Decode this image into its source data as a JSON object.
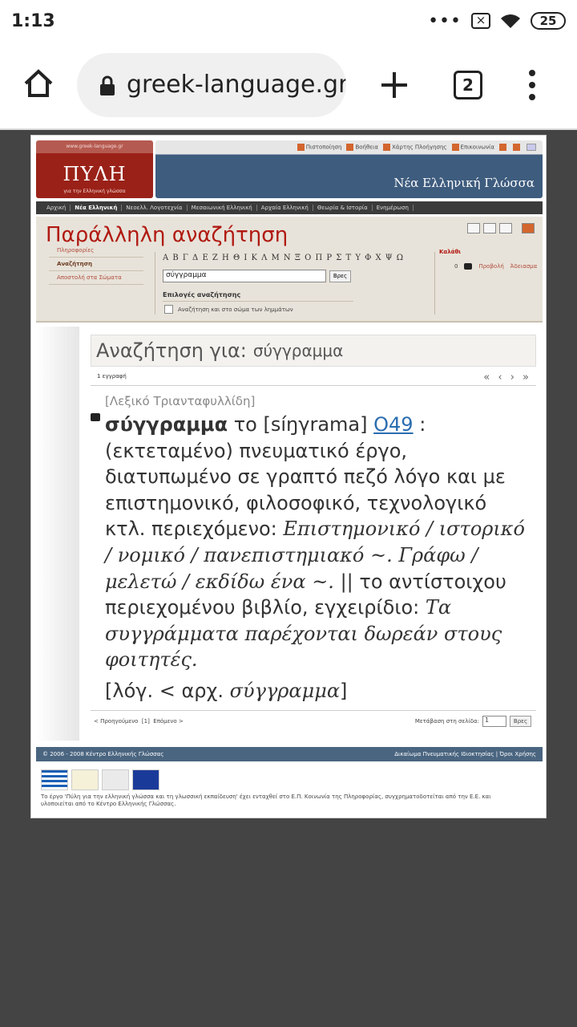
{
  "status": {
    "time": "1:13",
    "battery": "25"
  },
  "browser": {
    "url": "greek-language.gr",
    "tab_count": "2"
  },
  "site": {
    "logo_site": "www.greek-language.gr",
    "logo_brand": "ΠΥΛΗ",
    "logo_tagline": "για την Ελληνική γλώσσα",
    "header_links": [
      "Πιστοποίηση",
      "Βοήθεια",
      "Χάρτης Πλοήγησης",
      "Επικοινωνία"
    ],
    "header_title": "Νέα Ελληνική Γλώσσα",
    "nav": [
      "Αρχική",
      "Νέα Ελληνική",
      "Νεοελλ. Λογοτεχνία",
      "Μεσαιωνική Ελληνική",
      "Αρχαία Ελληνική",
      "Θεωρία & Ιστορία",
      "Ενημέρωση"
    ],
    "nav_active": "Νέα Ελληνική"
  },
  "search": {
    "title": "Παράλληλη αναζήτηση",
    "menu": [
      "Πληροφορίες",
      "Αναζήτηση",
      "Αποστολή στα Σώματα"
    ],
    "alphabet": "Α Β Γ Δ Ε Ζ Η Θ Ι Κ Λ Μ Ν Ξ Ο Π Ρ Σ Τ Υ Φ Χ Ψ Ω",
    "input_value": "σύγγραμμα",
    "button": "Βρες",
    "options_title": "Επιλογές αναζήτησης",
    "option_label": "Αναζήτηση και στο σώμα των λημμάτων",
    "cart_title": "Καλάθι",
    "cart_count": "0",
    "cart_view": "Προβολή",
    "cart_empty": "Άδειασμα"
  },
  "results": {
    "label": "Αναζήτηση για:",
    "term": "σύγγραμμα",
    "count": "1 εγγραφή",
    "dictionary": "[Λεξικό Τριανταφυλλίδη]",
    "headword": "σύγγραμμα",
    "article": "το",
    "pron": "[síŋγrama]",
    "code": "Ο49",
    "def1": ": (εκτεταμένο) πνευματικό έργο, διατυπωμένο σε γραπτό πεζό λόγο και με επιστημονικό, φιλοσοφικό, τεχνολογικό κτλ. περιεχόμενο:",
    "ex1": "Επιστημονικό / ιστορικό / νομικό / πανεπιστημιακό ~. Γράφω / μελετώ / εκδίδω ένα ~.",
    "def2": "|| το αντίστοιχου περιεχομένου βιβλίο, εγχειρίδιο:",
    "ex2": "Τα συγγράμματα παρέχονται δωρεάν στους φοιτητές.",
    "ety_prefix": "[λόγ. < αρχ.",
    "ety_word": "σύγγραμμα",
    "ety_suffix": "]",
    "pager_prev": "< Προηγούμενο",
    "pager_page": "[1]",
    "pager_next": "Επόμενο >",
    "goto_label": "Μετάβαση στη σελίδα:",
    "goto_value": "1",
    "goto_button": "Βρες"
  },
  "footer": {
    "copyright": "© 2006 - 2008 Κέντρο Ελληνικής Γλώσσας",
    "links": "Δικαίωμα Πνευματικής Ιδιοκτησίας | Όροι Χρήσης",
    "fine": "Το έργο 'Πύλη για την ελληνική γλώσσα και τη γλωσσική εκπαίδευση' έχει ενταχθεί στο Ε.Π. Κοινωνία της Πληροφορίας, συγχρηματοδοτείται από την Ε.Ε. και υλοποιείται από το Κέντρο Ελληνικής Γλώσσας."
  }
}
